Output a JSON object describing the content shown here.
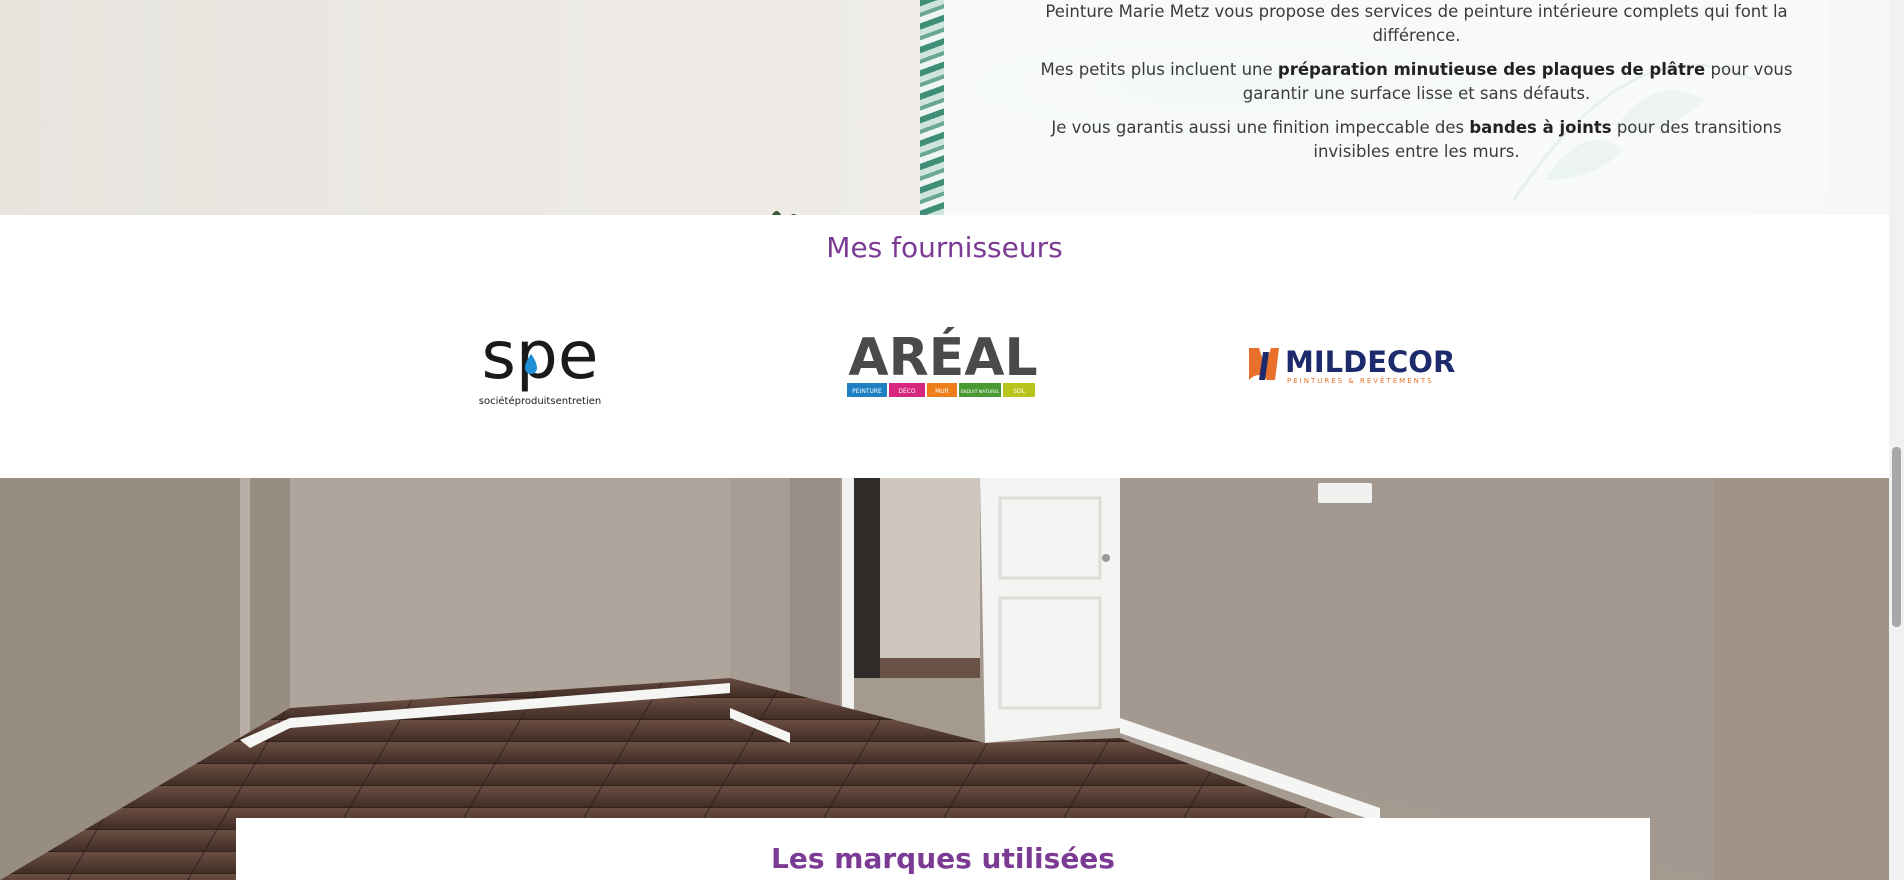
{
  "intro": {
    "line1": "Peinture Marie Metz vous propose des services de peinture intérieure complets qui font la différence.",
    "line2_pre": "Mes petits plus incluent une ",
    "line2_bold": "préparation minutieuse des plaques de plâtre",
    "line2_post": " pour vous garantir une surface lisse et sans défauts.",
    "line3_pre": "Je vous garantis aussi une finition impeccable des ",
    "line3_bold": "bandes à joints",
    "line3_post": " pour des transitions invisibles entre les murs."
  },
  "suppliers": {
    "title": "Mes fournisseurs",
    "logos": [
      {
        "name": "spe",
        "wordmark": "spe",
        "tagline": "sociétéproduitsentretien"
      },
      {
        "name": "areal",
        "wordmark": "ARÉAL",
        "tags": [
          "PEINTURE",
          "DÉCO",
          "MUR",
          "ENDUIT NATUREL",
          "SOL"
        ]
      },
      {
        "name": "mildecor",
        "wordmark": "MILDECOR",
        "tagline": "PEINTURES & REVÊTEMENTS"
      }
    ]
  },
  "brands": {
    "title": "Les marques utilisées"
  },
  "colors": {
    "accent": "#7b3a93",
    "text": "#3b3b3b",
    "areal_tags": [
      "#1e7fc2",
      "#d6267f",
      "#ef7d1a",
      "#4a9a34",
      "#b9c41d"
    ],
    "mildecor_blue": "#1d2a6b",
    "mildecor_orange": "#e8702a"
  }
}
